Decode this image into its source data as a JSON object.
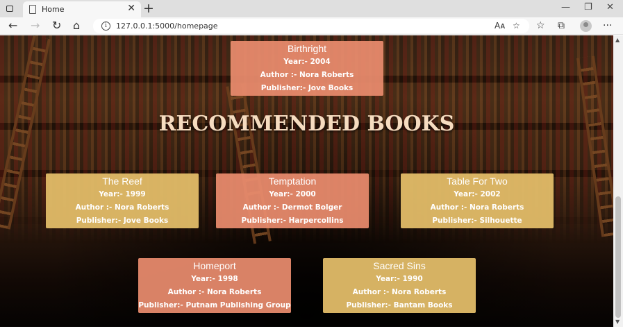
{
  "browser": {
    "tab": {
      "title": "Home",
      "close_glyph": "✕"
    },
    "new_tab_glyph": "+",
    "window": {
      "minimize_glyph": "—",
      "restore_glyph": "❐",
      "close_glyph": "✕"
    },
    "nav": {
      "back_glyph": "←",
      "forward_glyph": "→",
      "reload_glyph": "↻",
      "home_glyph": "⌂"
    },
    "address": {
      "url": "127.0.0.1:5000/homepage",
      "info_glyph": "i"
    },
    "toolbar_icons": {
      "read_aloud": "Aᴀ",
      "add_favorite": "☆",
      "favorites": "☆",
      "collections": "⧉",
      "more": "···"
    }
  },
  "page": {
    "heading": "RECOMMENDED BOOKS",
    "featured": {
      "title": "Birthright",
      "year": "Year:- 2004",
      "author": "Author :- Nora Roberts",
      "publisher": "Publisher:- Jove Books",
      "color": "#ea8c6e"
    },
    "books": [
      {
        "title": "The Reef",
        "year": "Year:- 1999",
        "author": "Author :- Nora Roberts",
        "publisher": "Publisher:- Jove Books",
        "color": "#e2bc68"
      },
      {
        "title": "Temptation",
        "year": "Year:- 2000",
        "author": "Author :- Dermot Bolger",
        "publisher": "Publisher:- Harpercollins",
        "color": "#ea8c6e"
      },
      {
        "title": "Table For Two",
        "year": "Year:- 2002",
        "author": "Author :- Nora Roberts",
        "publisher": "Publisher:- Silhouette",
        "color": "#e2bc68"
      },
      {
        "title": "Homeport",
        "year": "Year:- 1998",
        "author": "Author :- Nora Roberts",
        "publisher": "Publisher:- Putnam Publishing Group",
        "color": "#ea8c6e"
      },
      {
        "title": "Sacred Sins",
        "year": "Year:- 1990",
        "author": "Author :- Nora Roberts",
        "publisher": "Publisher:- Bantam Books",
        "color": "#e2bc68"
      }
    ]
  },
  "colors": {
    "heading": "#f6dcc0",
    "salmon_card": "#ea8c6e",
    "gold_card": "#e2bc68"
  }
}
